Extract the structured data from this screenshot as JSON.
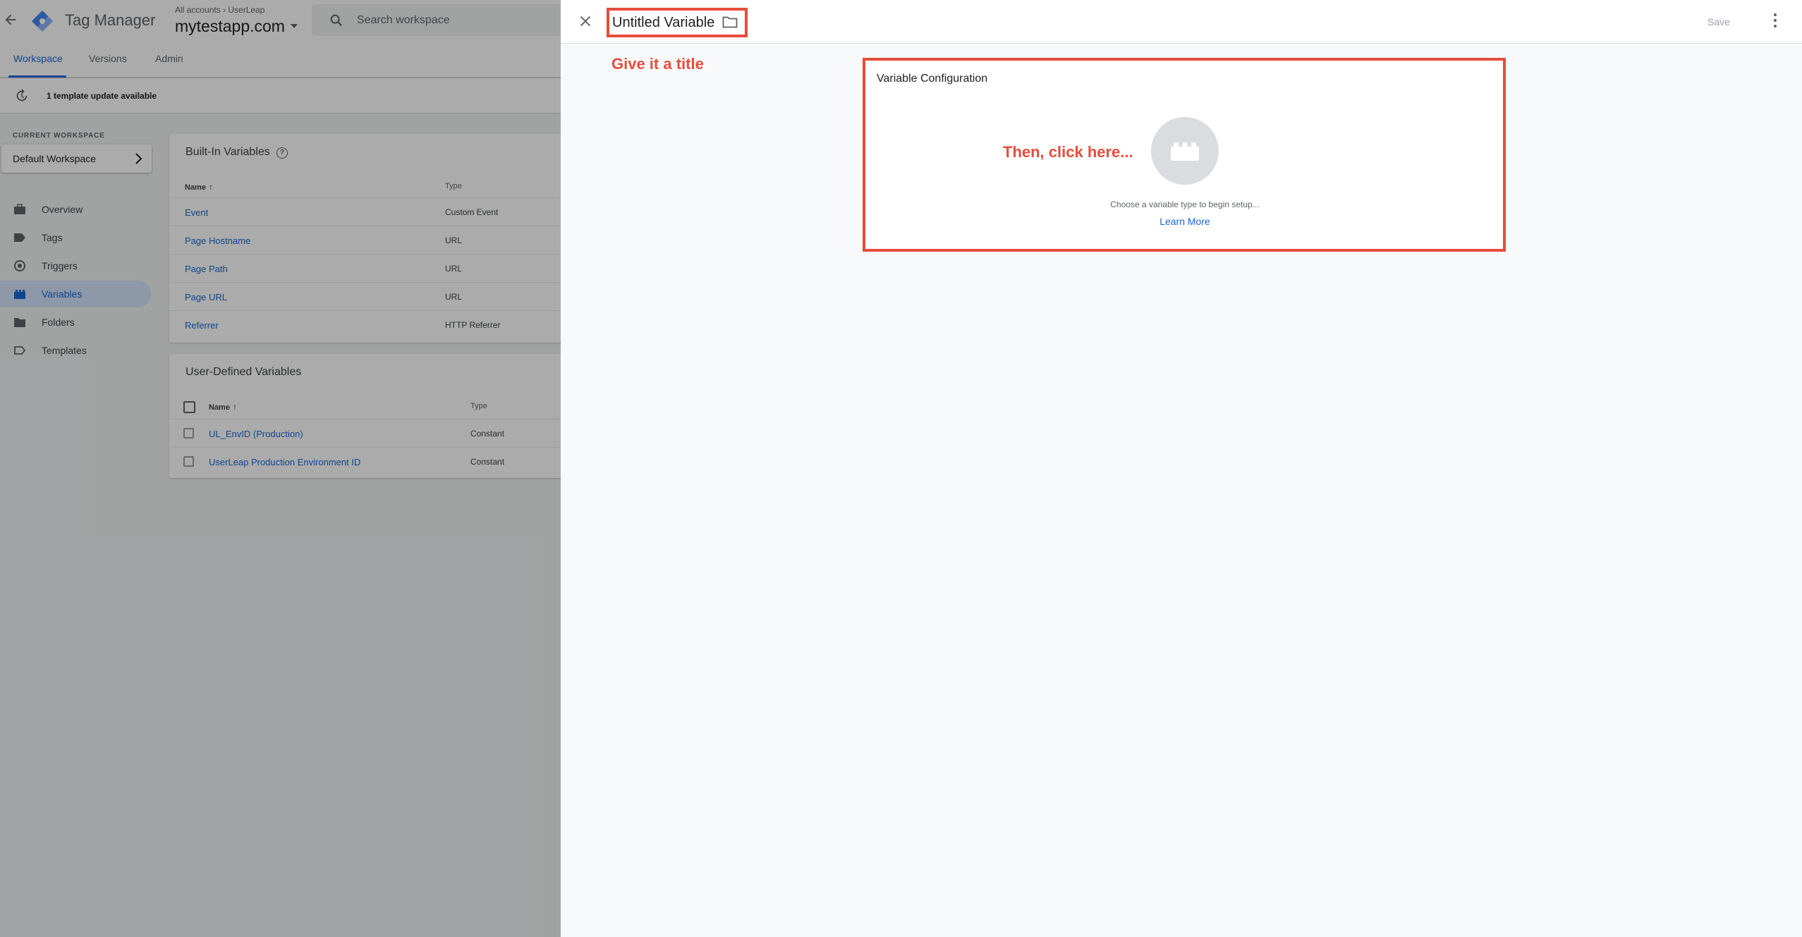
{
  "app": {
    "product_name": "Tag Manager",
    "account_crumb": "All accounts › UserLeap",
    "container_name": "mytestapp.com",
    "search_placeholder": "Search workspace"
  },
  "tabs": [
    {
      "label": "Workspace",
      "active": true
    },
    {
      "label": "Versions",
      "active": false
    },
    {
      "label": "Admin",
      "active": false
    }
  ],
  "notice": {
    "text": "1 template update available"
  },
  "workspace": {
    "label": "CURRENT WORKSPACE",
    "name": "Default Workspace"
  },
  "sidebar": {
    "items": [
      {
        "label": "Overview",
        "icon": "briefcase-icon",
        "active": false
      },
      {
        "label": "Tags",
        "icon": "tag-icon",
        "active": false
      },
      {
        "label": "Triggers",
        "icon": "trigger-icon",
        "active": false
      },
      {
        "label": "Variables",
        "icon": "variables-icon",
        "active": true
      },
      {
        "label": "Folders",
        "icon": "folder-icon",
        "active": false
      },
      {
        "label": "Templates",
        "icon": "template-icon",
        "active": false
      }
    ]
  },
  "builtin": {
    "title": "Built-In Variables",
    "help_glyph": "?",
    "col_name": "Name",
    "col_type": "Type",
    "rows": [
      {
        "name": "Event",
        "type": "Custom Event"
      },
      {
        "name": "Page Hostname",
        "type": "URL"
      },
      {
        "name": "Page Path",
        "type": "URL"
      },
      {
        "name": "Page URL",
        "type": "URL"
      },
      {
        "name": "Referrer",
        "type": "HTTP Referrer"
      }
    ]
  },
  "userdefined": {
    "title": "User-Defined Variables",
    "col_name": "Name",
    "col_type": "Type",
    "rows": [
      {
        "name": "UL_EnvID (Production)",
        "type": "Constant"
      },
      {
        "name": "UserLeap Production Environment ID",
        "type": "Constant"
      }
    ]
  },
  "panel": {
    "title": "Untitled Variable",
    "save_label": "Save",
    "config_title": "Variable Configuration",
    "config_hint": "Choose a variable type to begin setup...",
    "learn_more": "Learn More"
  },
  "annotations": {
    "title_hint": "Give it a title",
    "click_hint": "Then, click here..."
  },
  "colors": {
    "accent": "#1967d2",
    "annotation": "#e74c3c",
    "active_nav_bg": "#d2e3fc"
  }
}
